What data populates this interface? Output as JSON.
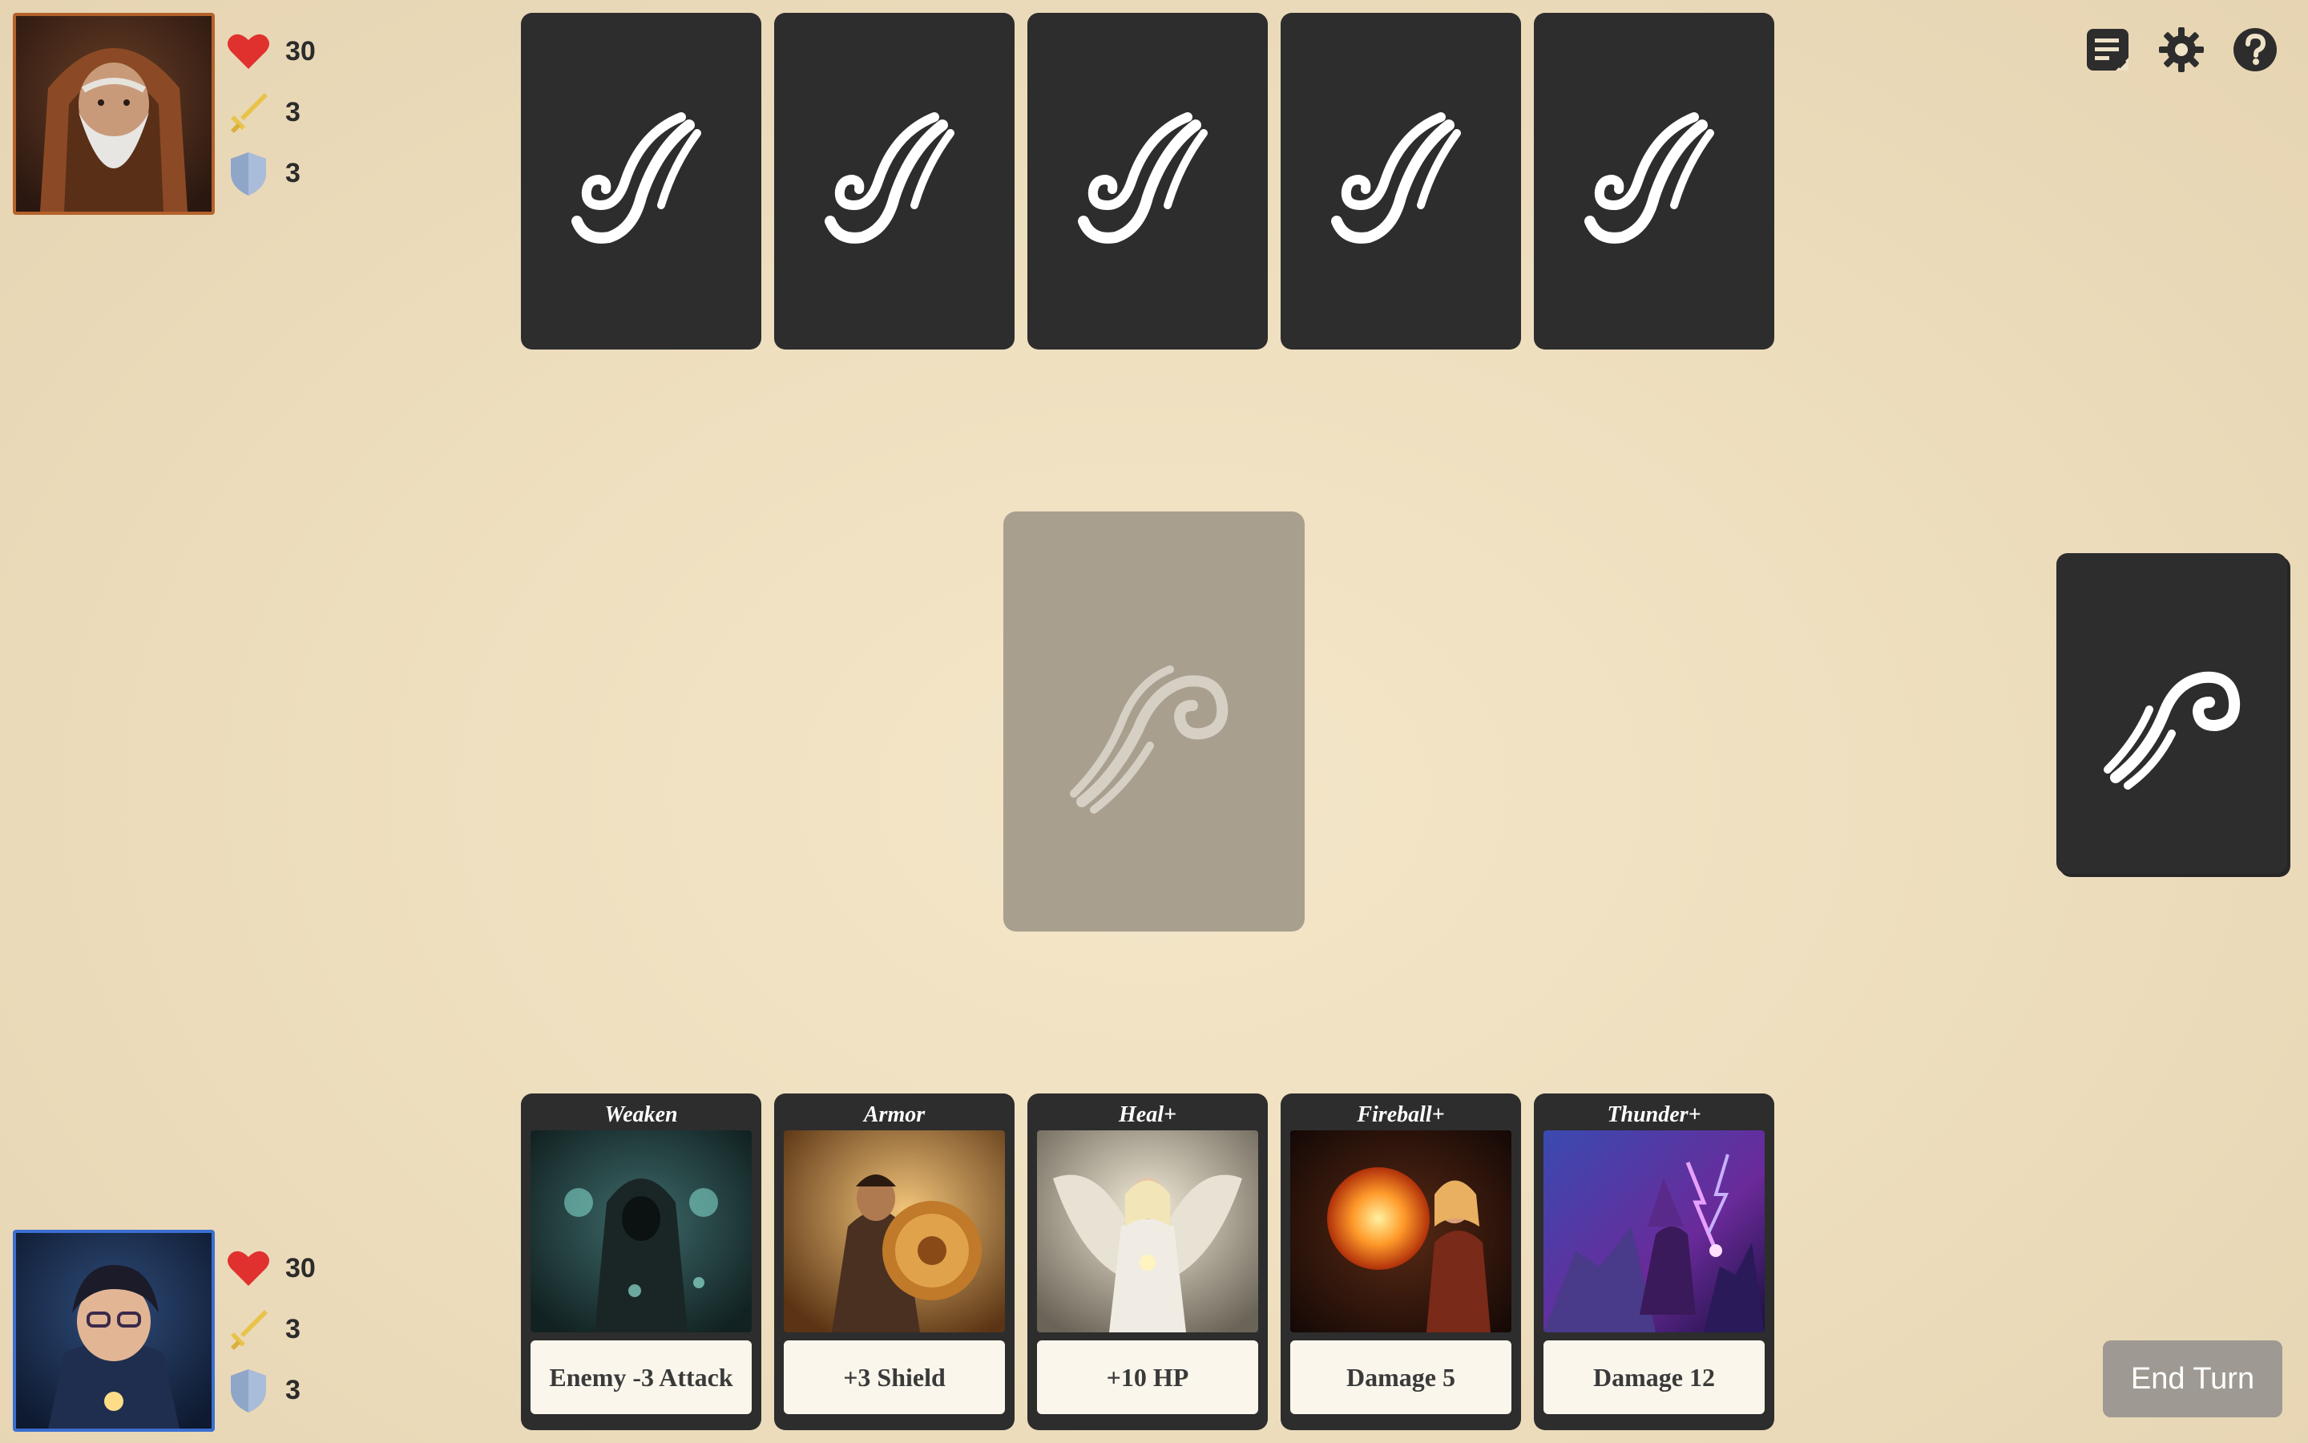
{
  "enemy": {
    "portrait_icon": "old-wizard-portrait",
    "border_color": "#b4622c",
    "health": "30",
    "attack": "3",
    "shield": "3"
  },
  "player": {
    "portrait_icon": "young-wizard-portrait",
    "border_color": "#3b6fd0",
    "health": "30",
    "attack": "3",
    "shield": "3"
  },
  "enemy_hand": {
    "count": 5,
    "card_back_icon": "swirl-icon"
  },
  "play_area": {
    "icon": "swirl-icon"
  },
  "deck": {
    "icon": "swirl-icon"
  },
  "player_hand": [
    {
      "title": "Weaken",
      "description": "Enemy -3 Attack",
      "art": "hooded-sorcerer"
    },
    {
      "title": "Armor",
      "description": "+3 Shield",
      "art": "warrior-with-shield"
    },
    {
      "title": "Heal+",
      "description": "+10 HP",
      "art": "angel"
    },
    {
      "title": "Fireball+",
      "description": "Damage 5",
      "art": "fire-mage"
    },
    {
      "title": "Thunder+",
      "description": "Damage 12",
      "art": "storm-wizard"
    }
  ],
  "toolbar": {
    "log_icon": "log-icon",
    "settings_icon": "gear-icon",
    "help_icon": "help-icon"
  },
  "end_turn_label": "End Turn",
  "colors": {
    "card": "#2d2d2d",
    "heart": "#e0312f",
    "sword": "#e8c34a",
    "shield": "#8fa6c9",
    "end_turn": "#9e9a93"
  }
}
